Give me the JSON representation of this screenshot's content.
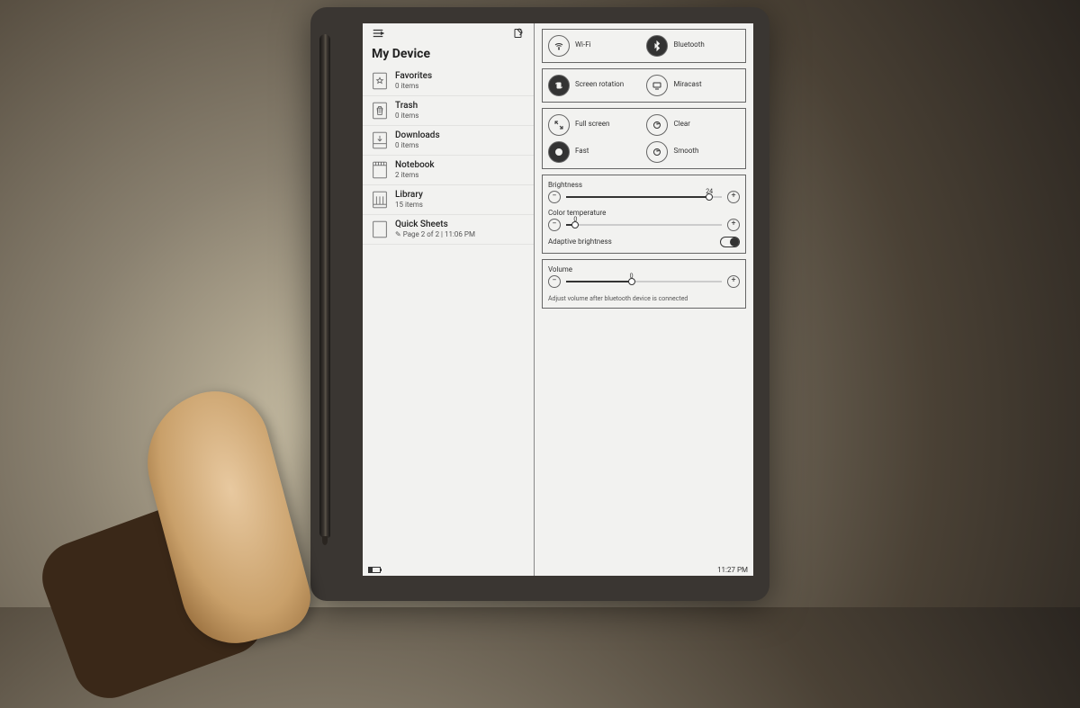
{
  "header": {
    "title": "My Device"
  },
  "folders": [
    {
      "icon": "star",
      "name": "Favorites",
      "sub": "0 items"
    },
    {
      "icon": "trash",
      "name": "Trash",
      "sub": "0 items"
    },
    {
      "icon": "download",
      "name": "Downloads",
      "sub": "0 items"
    },
    {
      "icon": "notebook",
      "name": "Notebook",
      "sub": "2 items"
    },
    {
      "icon": "library",
      "name": "Library",
      "sub": "15 items"
    },
    {
      "icon": "sheet",
      "name": "Quick Sheets",
      "sub": "✎ Page 2 of 2  |  11:06 PM"
    }
  ],
  "toggles": {
    "wifi": {
      "label": "Wi-Fi",
      "active": false
    },
    "bt": {
      "label": "Bluetooth",
      "active": true
    },
    "rotation": {
      "label": "Screen rotation",
      "active": true
    },
    "miracast": {
      "label": "Miracast",
      "active": false
    },
    "full": {
      "label": "Full screen",
      "active": false
    },
    "clear": {
      "label": "Clear",
      "active": false
    },
    "fast": {
      "label": "Fast",
      "active": true
    },
    "smooth": {
      "label": "Smooth",
      "active": false
    }
  },
  "sliders": {
    "brightness": {
      "label": "Brightness",
      "value": "24",
      "pct": 92
    },
    "colortemp": {
      "label": "Color temperature",
      "value": "0",
      "pct": 6
    },
    "volume": {
      "label": "Volume",
      "value": "0",
      "pct": 42
    }
  },
  "adaptive": {
    "label": "Adaptive brightness",
    "on": true
  },
  "volume_hint": "Adjust volume after bluetooth device is connected",
  "status": {
    "time": "11:27 PM"
  }
}
